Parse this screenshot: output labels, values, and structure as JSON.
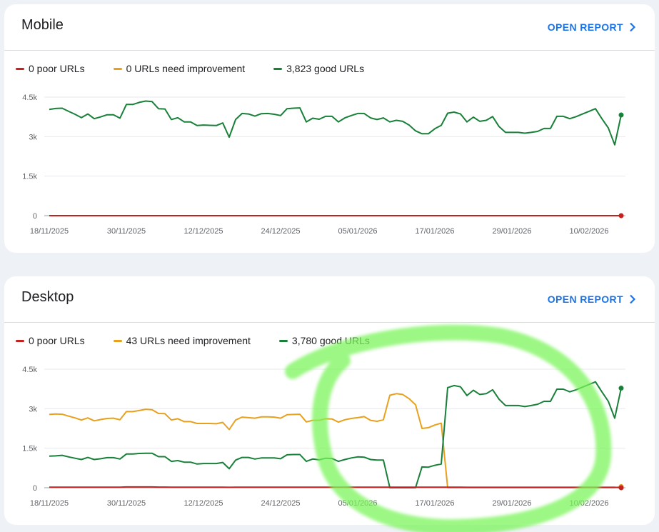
{
  "colors": {
    "poor": "#c5221f",
    "improvement": "#e8a01d",
    "good": "#188038",
    "accent": "#1a73e8",
    "highlight": "#7cf55c"
  },
  "icons": {
    "open_report_chevron": "chevron-right-icon"
  },
  "mobile": {
    "title": "Mobile",
    "open_report": "OPEN REPORT",
    "legend": [
      {
        "key": "poor",
        "label": "0 poor URLs"
      },
      {
        "key": "improvement",
        "label": "0 URLs need improvement"
      },
      {
        "key": "good",
        "label": "3,823 good URLs"
      }
    ]
  },
  "desktop": {
    "title": "Desktop",
    "open_report": "OPEN REPORT",
    "legend": [
      {
        "key": "poor",
        "label": "0 poor URLs"
      },
      {
        "key": "improvement",
        "label": "43 URLs need improvement"
      },
      {
        "key": "good",
        "label": "3,780 good URLs"
      }
    ]
  },
  "chart_data": [
    {
      "type": "line",
      "x_labels": [
        "18/11/2025",
        "30/11/2025",
        "12/12/2025",
        "24/12/2025",
        "05/01/2026",
        "17/01/2026",
        "29/01/2026",
        "10/02/2026"
      ],
      "y_ticks": [
        "0",
        "1.5k",
        "3k",
        "4.5k"
      ],
      "ylim": [
        0,
        4500
      ],
      "grid": true,
      "series": [
        {
          "key": "good",
          "values": [
            4030,
            4070,
            4080,
            3960,
            3850,
            3720,
            3860,
            3680,
            3750,
            3830,
            3830,
            3700,
            4220,
            4220,
            4300,
            4350,
            4330,
            4060,
            4050,
            3650,
            3720,
            3560,
            3560,
            3420,
            3440,
            3430,
            3420,
            3520,
            2980,
            3650,
            3880,
            3860,
            3780,
            3870,
            3880,
            3850,
            3800,
            4060,
            4080,
            4090,
            3560,
            3700,
            3660,
            3770,
            3770,
            3560,
            3710,
            3800,
            3880,
            3880,
            3710,
            3650,
            3710,
            3560,
            3620,
            3580,
            3440,
            3220,
            3110,
            3110,
            3300,
            3430,
            3890,
            3930,
            3860,
            3560,
            3740,
            3580,
            3620,
            3760,
            3380,
            3160,
            3160,
            3160,
            3130,
            3160,
            3200,
            3310,
            3310,
            3770,
            3770,
            3680,
            3760,
            3860,
            3960,
            4060,
            3680,
            3330,
            2690,
            3823
          ]
        },
        {
          "key": "improvement",
          "values": [
            0,
            0,
            0,
            0,
            0,
            0,
            0,
            0,
            0,
            0,
            0,
            0,
            0,
            0,
            0,
            0,
            0,
            0,
            0,
            0,
            0,
            0,
            0,
            0,
            0,
            0,
            0,
            0,
            0,
            0,
            0,
            0,
            0,
            0,
            0,
            0,
            0,
            0,
            0,
            0,
            0,
            0,
            0,
            0,
            0,
            0,
            0,
            0,
            0,
            0,
            0,
            0,
            0,
            0,
            0,
            0,
            0,
            0,
            0,
            0,
            0,
            0,
            0,
            0,
            0,
            0,
            0,
            0,
            0,
            0,
            0,
            0,
            0,
            0,
            0,
            0,
            0,
            0,
            0,
            0,
            0,
            0,
            0,
            0,
            0,
            0,
            0,
            0,
            0,
            0
          ]
        },
        {
          "key": "poor",
          "values": [
            0,
            0,
            0,
            0,
            0,
            0,
            0,
            0,
            0,
            0,
            0,
            0,
            0,
            0,
            0,
            0,
            0,
            0,
            0,
            0,
            0,
            0,
            0,
            0,
            0,
            0,
            0,
            0,
            0,
            0,
            0,
            0,
            0,
            0,
            0,
            0,
            0,
            0,
            0,
            0,
            0,
            0,
            0,
            0,
            0,
            0,
            0,
            0,
            0,
            0,
            0,
            0,
            0,
            0,
            0,
            0,
            0,
            0,
            0,
            0,
            0,
            0,
            0,
            0,
            0,
            0,
            0,
            0,
            0,
            0,
            0,
            0,
            0,
            0,
            0,
            0,
            0,
            0,
            0,
            0,
            0,
            0,
            0,
            0,
            0,
            0,
            0,
            0,
            0,
            0
          ]
        }
      ]
    },
    {
      "type": "line",
      "x_labels": [
        "18/11/2025",
        "30/11/2025",
        "12/12/2025",
        "24/12/2025",
        "05/01/2026",
        "17/01/2026",
        "29/01/2026",
        "10/02/2026"
      ],
      "y_ticks": [
        "0",
        "1.5k",
        "3k",
        "4.5k"
      ],
      "ylim": [
        0,
        4500
      ],
      "grid": true,
      "series": [
        {
          "key": "improvement",
          "values": [
            2780,
            2800,
            2790,
            2720,
            2650,
            2570,
            2650,
            2540,
            2590,
            2630,
            2640,
            2580,
            2890,
            2890,
            2930,
            2980,
            2960,
            2820,
            2810,
            2570,
            2620,
            2510,
            2510,
            2440,
            2440,
            2440,
            2430,
            2480,
            2210,
            2570,
            2680,
            2660,
            2640,
            2690,
            2690,
            2680,
            2640,
            2770,
            2780,
            2790,
            2500,
            2560,
            2560,
            2620,
            2610,
            2490,
            2580,
            2630,
            2660,
            2700,
            2560,
            2520,
            2580,
            3510,
            3570,
            3540,
            3380,
            3150,
            2250,
            2280,
            2380,
            2450,
            0,
            0,
            0,
            0,
            0,
            0,
            0,
            0,
            0,
            0,
            0,
            0,
            0,
            0,
            0,
            0,
            0,
            0,
            0,
            0,
            0,
            0,
            0,
            0,
            0,
            0,
            0,
            43
          ]
        },
        {
          "key": "good",
          "values": [
            1200,
            1210,
            1230,
            1170,
            1120,
            1070,
            1150,
            1070,
            1100,
            1140,
            1140,
            1090,
            1280,
            1280,
            1300,
            1310,
            1310,
            1180,
            1180,
            1000,
            1030,
            970,
            970,
            900,
            920,
            920,
            920,
            960,
            720,
            1050,
            1150,
            1150,
            1090,
            1130,
            1130,
            1130,
            1100,
            1250,
            1260,
            1260,
            1000,
            1090,
            1060,
            1120,
            1110,
            1000,
            1070,
            1130,
            1170,
            1160,
            1070,
            1050,
            1050,
            0,
            0,
            0,
            0,
            0,
            790,
            780,
            850,
            900,
            3800,
            3880,
            3830,
            3500,
            3700,
            3540,
            3570,
            3720,
            3360,
            3120,
            3120,
            3120,
            3080,
            3120,
            3170,
            3280,
            3280,
            3740,
            3740,
            3640,
            3720,
            3820,
            3920,
            4020,
            3640,
            3280,
            2640,
            3780
          ]
        },
        {
          "key": "poor",
          "values": [
            20,
            20,
            20,
            20,
            20,
            20,
            20,
            20,
            20,
            20,
            20,
            20,
            30,
            30,
            30,
            30,
            30,
            25,
            25,
            20,
            20,
            20,
            20,
            20,
            20,
            20,
            20,
            20,
            15,
            20,
            20,
            20,
            20,
            20,
            20,
            20,
            20,
            20,
            20,
            20,
            20,
            20,
            20,
            20,
            20,
            20,
            20,
            20,
            20,
            20,
            20,
            20,
            20,
            20,
            20,
            20,
            20,
            20,
            20,
            20,
            20,
            20,
            20,
            20,
            20,
            15,
            15,
            15,
            15,
            15,
            15,
            15,
            15,
            15,
            15,
            15,
            15,
            15,
            15,
            15,
            15,
            15,
            15,
            15,
            15,
            15,
            15,
            15,
            15,
            0
          ]
        }
      ]
    }
  ]
}
